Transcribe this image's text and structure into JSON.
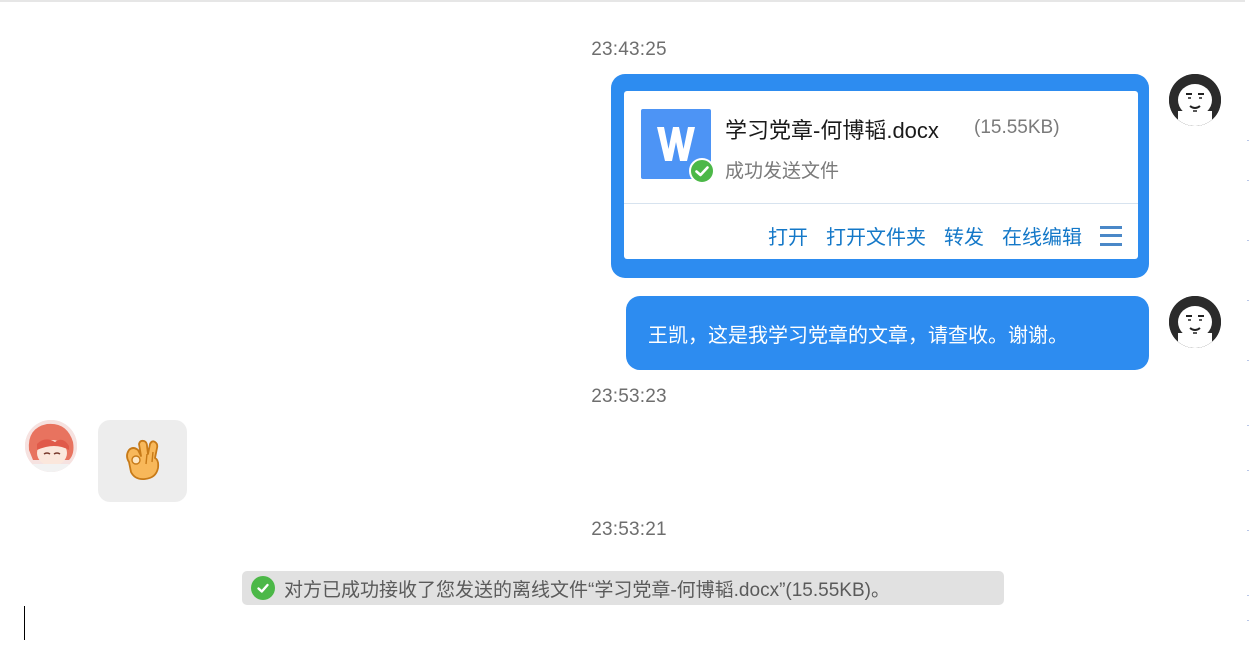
{
  "chat": {
    "messages": [
      {
        "timestamp": "23:43:25",
        "file": {
          "name": "学习党章-何博韬.docx",
          "size": "(15.55KB)",
          "status": "成功发送文件",
          "icon": "word-doc-icon",
          "actions": [
            "打开",
            "打开文件夹",
            "转发",
            "在线编辑"
          ],
          "menu_icon": "hamburger-menu-icon"
        }
      },
      {
        "text": "王凯，这是我学习党章的文章，请查收。谢谢。"
      },
      {
        "timestamp": "23:53:23",
        "emoji": "ok-hand-emoji"
      },
      {
        "timestamp": "23:53:21",
        "notice": "对方已成功接收了您发送的离线文件“学习党章-何博韬.docx”(15.55KB)。"
      }
    ]
  },
  "colors": {
    "outgoing_bubble": "#2d8cf0",
    "incoming_bubble": "#ededed",
    "action_link": "#1478c8",
    "success_green": "#4cb848",
    "notice_bg": "#e1e1e1"
  }
}
